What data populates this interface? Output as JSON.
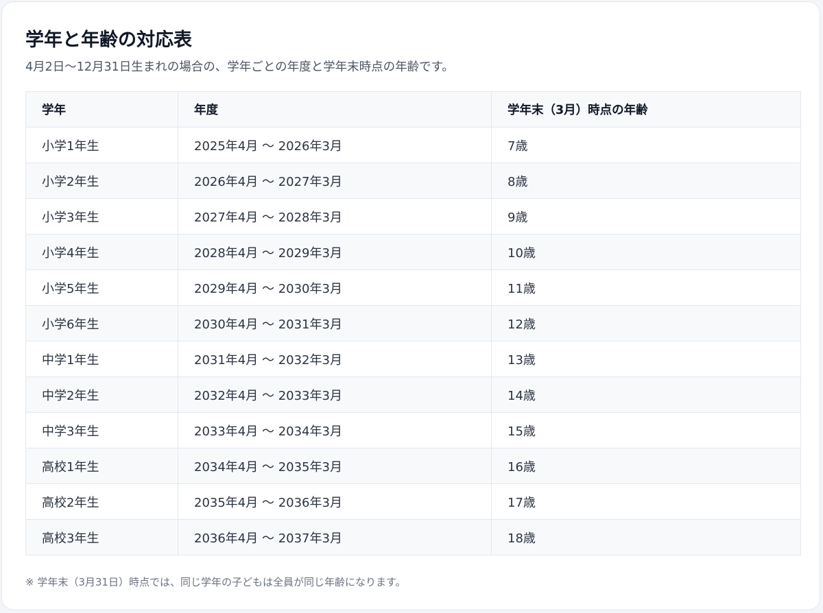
{
  "title": "学年と年齢の対応表",
  "subtitle": "4月2日〜12月31日生まれの場合の、学年ごとの年度と学年末時点の年齢です。",
  "table": {
    "headers": [
      "学年",
      "年度",
      "学年末（3月）時点の年齢"
    ],
    "rows": [
      [
        "小学1年生",
        "2025年4月 〜 2026年3月",
        "7歳"
      ],
      [
        "小学2年生",
        "2026年4月 〜 2027年3月",
        "8歳"
      ],
      [
        "小学3年生",
        "2027年4月 〜 2028年3月",
        "9歳"
      ],
      [
        "小学4年生",
        "2028年4月 〜 2029年3月",
        "10歳"
      ],
      [
        "小学5年生",
        "2029年4月 〜 2030年3月",
        "11歳"
      ],
      [
        "小学6年生",
        "2030年4月 〜 2031年3月",
        "12歳"
      ],
      [
        "中学1年生",
        "2031年4月 〜 2032年3月",
        "13歳"
      ],
      [
        "中学2年生",
        "2032年4月 〜 2033年3月",
        "14歳"
      ],
      [
        "中学3年生",
        "2033年4月 〜 2034年3月",
        "15歳"
      ],
      [
        "高校1年生",
        "2034年4月 〜 2035年3月",
        "16歳"
      ],
      [
        "高校2年生",
        "2035年4月 〜 2036年3月",
        "17歳"
      ],
      [
        "高校3年生",
        "2036年4月 〜 2037年3月",
        "18歳"
      ]
    ]
  },
  "note": "※ 学年末（3月31日）時点では、同じ学年の子どもは全員が同じ年齢になります。"
}
